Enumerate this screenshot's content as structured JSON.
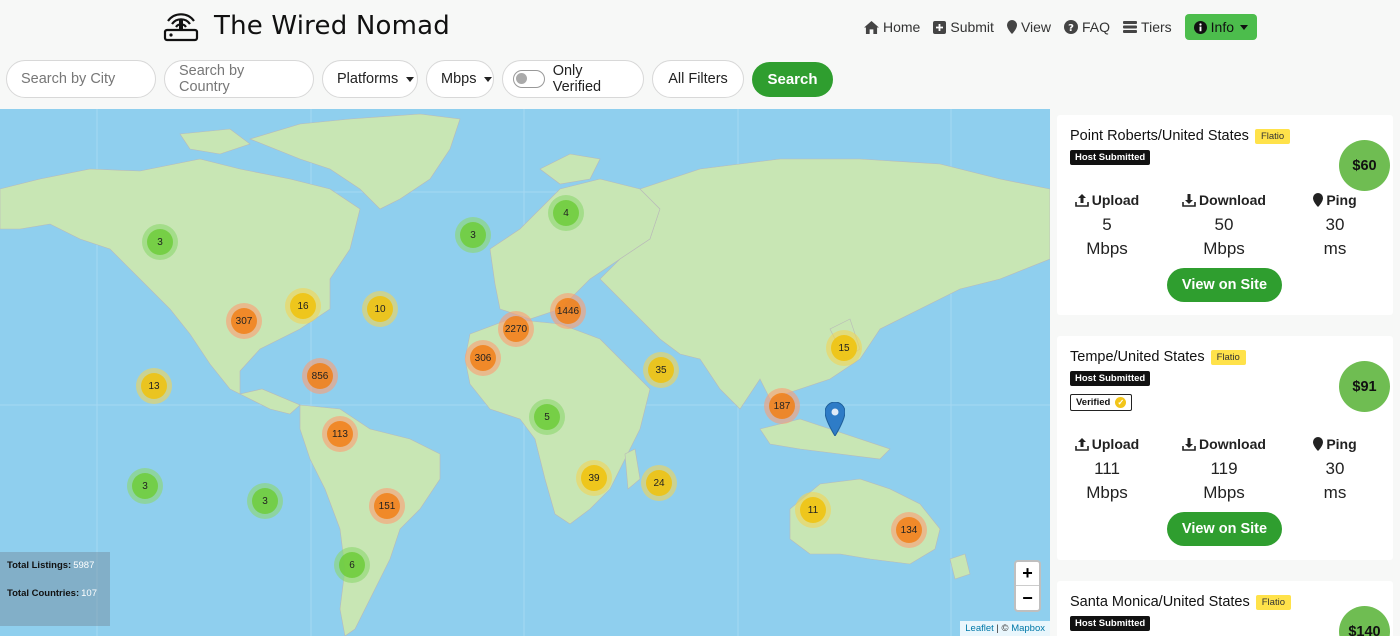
{
  "brand": {
    "title": "The Wired Nomad",
    "logo_icon": "router-icon"
  },
  "nav": [
    {
      "label": "Home",
      "icon": "home-icon"
    },
    {
      "label": "Submit",
      "icon": "plus-square-icon"
    },
    {
      "label": "View",
      "icon": "map-pin-icon"
    },
    {
      "label": "FAQ",
      "icon": "question-circle-icon"
    },
    {
      "label": "Tiers",
      "icon": "list-icon"
    },
    {
      "label": "Info",
      "icon": "info-circle-icon"
    }
  ],
  "filters": {
    "city_placeholder": "Search by City",
    "country_placeholder": "Search by Country",
    "platforms_label": "Platforms",
    "speed_label": "Mbps",
    "verified_label": "Only Verified",
    "all_filters_label": "All Filters",
    "search_label": "Search"
  },
  "map": {
    "clusters": [
      {
        "count": "3",
        "color": "green"
      },
      {
        "count": "3",
        "color": "green"
      },
      {
        "count": "4",
        "color": "green"
      },
      {
        "count": "16",
        "color": "yellow"
      },
      {
        "count": "10",
        "color": "yellow"
      },
      {
        "count": "307",
        "color": "orange"
      },
      {
        "count": "1446",
        "color": "orange"
      },
      {
        "count": "2270",
        "color": "orange"
      },
      {
        "count": "306",
        "color": "orange"
      },
      {
        "count": "35",
        "color": "yellow"
      },
      {
        "count": "15",
        "color": "yellow"
      },
      {
        "count": "856",
        "color": "orange"
      },
      {
        "count": "13",
        "color": "yellow"
      },
      {
        "count": "187",
        "color": "orange"
      },
      {
        "count": "5",
        "color": "green"
      },
      {
        "count": "113",
        "color": "orange"
      },
      {
        "count": "3",
        "color": "green"
      },
      {
        "count": "3",
        "color": "green"
      },
      {
        "count": "39",
        "color": "yellow"
      },
      {
        "count": "24",
        "color": "yellow"
      },
      {
        "count": "151",
        "color": "orange"
      },
      {
        "count": "11",
        "color": "yellow"
      },
      {
        "count": "134",
        "color": "orange"
      },
      {
        "count": "6",
        "color": "green"
      }
    ],
    "stats": {
      "listings_label": "Total Listings:",
      "listings_value": "5987",
      "countries_label": "Total Countries:",
      "countries_value": "107"
    },
    "zoom_in": "+",
    "zoom_out": "−",
    "attribution_leaflet": "Leaflet",
    "attribution_sep": " | © ",
    "attribution_mapbox": "Mapbox"
  },
  "listings": [
    {
      "title": "Point Roberts/United States",
      "provider": "Flatio",
      "host_tag": "Host Submitted",
      "verified": "",
      "price": "$60",
      "upload_label": "Upload",
      "upload_value": "5",
      "upload_unit": "Mbps",
      "download_label": "Download",
      "download_value": "50",
      "download_unit": "Mbps",
      "ping_label": "Ping",
      "ping_value": "30",
      "ping_unit": "ms",
      "button": "View on Site"
    },
    {
      "title": "Tempe/United States",
      "provider": "Flatio",
      "host_tag": "Host Submitted",
      "verified": "Verified",
      "price": "$91",
      "upload_label": "Upload",
      "upload_value": "111",
      "upload_unit": "Mbps",
      "download_label": "Download",
      "download_value": "119",
      "download_unit": "Mbps",
      "ping_label": "Ping",
      "ping_value": "30",
      "ping_unit": "ms",
      "button": "View on Site"
    },
    {
      "title": "Santa Monica/United States",
      "provider": "Flatio",
      "host_tag": "Host Submitted",
      "price": "$140"
    }
  ],
  "colors": {
    "accent_green": "#2f9e2f",
    "info_green": "#4cbd4c",
    "price_green": "#6fbd52",
    "flatio_yellow": "#ffe24a",
    "ocean": "#8fcfee",
    "land": "#c8e6b4"
  }
}
